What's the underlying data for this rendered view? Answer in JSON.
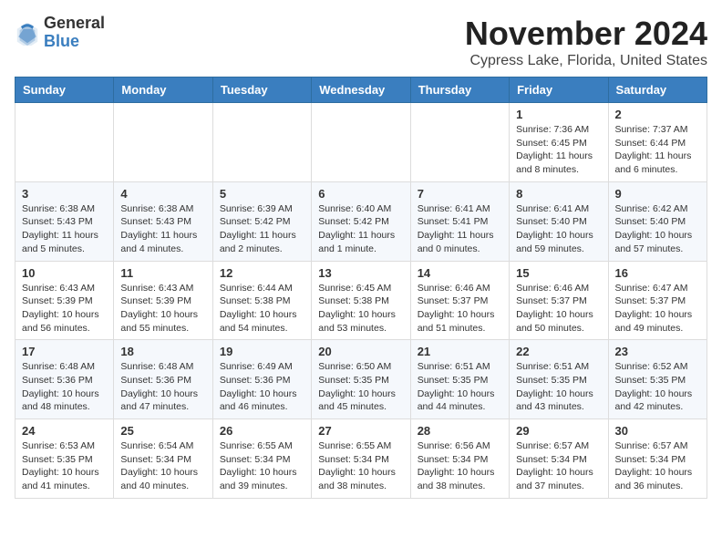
{
  "header": {
    "logo_general": "General",
    "logo_blue": "Blue",
    "month_title": "November 2024",
    "location": "Cypress Lake, Florida, United States"
  },
  "weekdays": [
    "Sunday",
    "Monday",
    "Tuesday",
    "Wednesday",
    "Thursday",
    "Friday",
    "Saturday"
  ],
  "weeks": [
    [
      {
        "day": "",
        "info": ""
      },
      {
        "day": "",
        "info": ""
      },
      {
        "day": "",
        "info": ""
      },
      {
        "day": "",
        "info": ""
      },
      {
        "day": "",
        "info": ""
      },
      {
        "day": "1",
        "info": "Sunrise: 7:36 AM\nSunset: 6:45 PM\nDaylight: 11 hours\nand 8 minutes."
      },
      {
        "day": "2",
        "info": "Sunrise: 7:37 AM\nSunset: 6:44 PM\nDaylight: 11 hours\nand 6 minutes."
      }
    ],
    [
      {
        "day": "3",
        "info": "Sunrise: 6:38 AM\nSunset: 5:43 PM\nDaylight: 11 hours\nand 5 minutes."
      },
      {
        "day": "4",
        "info": "Sunrise: 6:38 AM\nSunset: 5:43 PM\nDaylight: 11 hours\nand 4 minutes."
      },
      {
        "day": "5",
        "info": "Sunrise: 6:39 AM\nSunset: 5:42 PM\nDaylight: 11 hours\nand 2 minutes."
      },
      {
        "day": "6",
        "info": "Sunrise: 6:40 AM\nSunset: 5:42 PM\nDaylight: 11 hours\nand 1 minute."
      },
      {
        "day": "7",
        "info": "Sunrise: 6:41 AM\nSunset: 5:41 PM\nDaylight: 11 hours\nand 0 minutes."
      },
      {
        "day": "8",
        "info": "Sunrise: 6:41 AM\nSunset: 5:40 PM\nDaylight: 10 hours\nand 59 minutes."
      },
      {
        "day": "9",
        "info": "Sunrise: 6:42 AM\nSunset: 5:40 PM\nDaylight: 10 hours\nand 57 minutes."
      }
    ],
    [
      {
        "day": "10",
        "info": "Sunrise: 6:43 AM\nSunset: 5:39 PM\nDaylight: 10 hours\nand 56 minutes."
      },
      {
        "day": "11",
        "info": "Sunrise: 6:43 AM\nSunset: 5:39 PM\nDaylight: 10 hours\nand 55 minutes."
      },
      {
        "day": "12",
        "info": "Sunrise: 6:44 AM\nSunset: 5:38 PM\nDaylight: 10 hours\nand 54 minutes."
      },
      {
        "day": "13",
        "info": "Sunrise: 6:45 AM\nSunset: 5:38 PM\nDaylight: 10 hours\nand 53 minutes."
      },
      {
        "day": "14",
        "info": "Sunrise: 6:46 AM\nSunset: 5:37 PM\nDaylight: 10 hours\nand 51 minutes."
      },
      {
        "day": "15",
        "info": "Sunrise: 6:46 AM\nSunset: 5:37 PM\nDaylight: 10 hours\nand 50 minutes."
      },
      {
        "day": "16",
        "info": "Sunrise: 6:47 AM\nSunset: 5:37 PM\nDaylight: 10 hours\nand 49 minutes."
      }
    ],
    [
      {
        "day": "17",
        "info": "Sunrise: 6:48 AM\nSunset: 5:36 PM\nDaylight: 10 hours\nand 48 minutes."
      },
      {
        "day": "18",
        "info": "Sunrise: 6:48 AM\nSunset: 5:36 PM\nDaylight: 10 hours\nand 47 minutes."
      },
      {
        "day": "19",
        "info": "Sunrise: 6:49 AM\nSunset: 5:36 PM\nDaylight: 10 hours\nand 46 minutes."
      },
      {
        "day": "20",
        "info": "Sunrise: 6:50 AM\nSunset: 5:35 PM\nDaylight: 10 hours\nand 45 minutes."
      },
      {
        "day": "21",
        "info": "Sunrise: 6:51 AM\nSunset: 5:35 PM\nDaylight: 10 hours\nand 44 minutes."
      },
      {
        "day": "22",
        "info": "Sunrise: 6:51 AM\nSunset: 5:35 PM\nDaylight: 10 hours\nand 43 minutes."
      },
      {
        "day": "23",
        "info": "Sunrise: 6:52 AM\nSunset: 5:35 PM\nDaylight: 10 hours\nand 42 minutes."
      }
    ],
    [
      {
        "day": "24",
        "info": "Sunrise: 6:53 AM\nSunset: 5:35 PM\nDaylight: 10 hours\nand 41 minutes."
      },
      {
        "day": "25",
        "info": "Sunrise: 6:54 AM\nSunset: 5:34 PM\nDaylight: 10 hours\nand 40 minutes."
      },
      {
        "day": "26",
        "info": "Sunrise: 6:55 AM\nSunset: 5:34 PM\nDaylight: 10 hours\nand 39 minutes."
      },
      {
        "day": "27",
        "info": "Sunrise: 6:55 AM\nSunset: 5:34 PM\nDaylight: 10 hours\nand 38 minutes."
      },
      {
        "day": "28",
        "info": "Sunrise: 6:56 AM\nSunset: 5:34 PM\nDaylight: 10 hours\nand 38 minutes."
      },
      {
        "day": "29",
        "info": "Sunrise: 6:57 AM\nSunset: 5:34 PM\nDaylight: 10 hours\nand 37 minutes."
      },
      {
        "day": "30",
        "info": "Sunrise: 6:57 AM\nSunset: 5:34 PM\nDaylight: 10 hours\nand 36 minutes."
      }
    ]
  ]
}
